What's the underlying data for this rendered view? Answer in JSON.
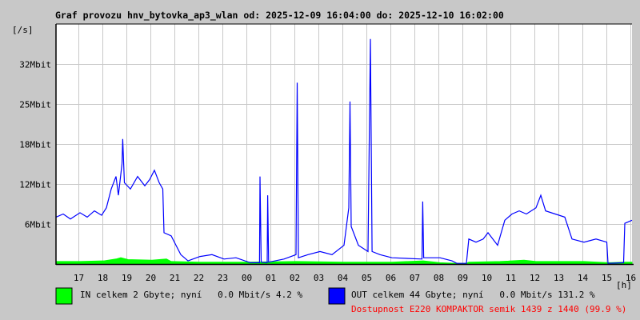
{
  "chart_data": {
    "type": "line",
    "title": "Graf provozu hnv_bytovka_ap3_wlan od: 2025-12-09 16:04:00 do: 2025-12-10 16:02:00",
    "ylabel": "[/s]",
    "xlabel": "[h]",
    "ylim": [
      0,
      38.4
    ],
    "x_unit": "hours since 16:04",
    "yticks": [
      {
        "value": 6.4,
        "label": "6Mbit"
      },
      {
        "value": 12.8,
        "label": "12Mbit"
      },
      {
        "value": 19.2,
        "label": "18Mbit"
      },
      {
        "value": 25.6,
        "label": "25Mbit"
      },
      {
        "value": 32,
        "label": "32Mbit"
      }
    ],
    "xticks": [
      {
        "value": 0.933,
        "label": "17"
      },
      {
        "value": 1.933,
        "label": "18"
      },
      {
        "value": 2.933,
        "label": "19"
      },
      {
        "value": 3.933,
        "label": "20"
      },
      {
        "value": 4.933,
        "label": "21"
      },
      {
        "value": 5.933,
        "label": "22"
      },
      {
        "value": 6.933,
        "label": "23"
      },
      {
        "value": 7.933,
        "label": "00"
      },
      {
        "value": 8.933,
        "label": "01"
      },
      {
        "value": 9.933,
        "label": "02"
      },
      {
        "value": 10.933,
        "label": "03"
      },
      {
        "value": 11.933,
        "label": "04"
      },
      {
        "value": 12.933,
        "label": "05"
      },
      {
        "value": 13.933,
        "label": "06"
      },
      {
        "value": 14.933,
        "label": "07"
      },
      {
        "value": 15.933,
        "label": "08"
      },
      {
        "value": 16.933,
        "label": "09"
      },
      {
        "value": 17.933,
        "label": "10"
      },
      {
        "value": 18.933,
        "label": "11"
      },
      {
        "value": 19.933,
        "label": "12"
      },
      {
        "value": 20.933,
        "label": "13"
      },
      {
        "value": 21.933,
        "label": "14"
      },
      {
        "value": 22.933,
        "label": "15"
      },
      {
        "value": 23.933,
        "label": "16"
      }
    ],
    "grid": true,
    "series": [
      {
        "name": "IN",
        "color": "#00ff00",
        "fill": true,
        "points": [
          [
            0,
            0.4
          ],
          [
            1,
            0.4
          ],
          [
            2,
            0.5
          ],
          [
            2.5,
            0.8
          ],
          [
            2.7,
            1.0
          ],
          [
            3,
            0.7
          ],
          [
            4,
            0.6
          ],
          [
            4.6,
            0.8
          ],
          [
            4.8,
            0.4
          ],
          [
            6,
            0.3
          ],
          [
            8,
            0.3
          ],
          [
            10,
            0.4
          ],
          [
            12,
            0.3
          ],
          [
            14,
            0.3
          ],
          [
            15.3,
            0.5
          ],
          [
            16,
            0.2
          ],
          [
            16.7,
            0.1
          ],
          [
            17.1,
            0.1
          ],
          [
            17.2,
            0.3
          ],
          [
            18.5,
            0.4
          ],
          [
            19.5,
            0.6
          ],
          [
            20,
            0.4
          ],
          [
            22,
            0.4
          ],
          [
            23,
            0.2
          ],
          [
            23.7,
            0.3
          ],
          [
            24,
            0.3
          ]
        ]
      },
      {
        "name": "OUT",
        "color": "#0000ff",
        "fill": false,
        "points": [
          [
            0,
            7.5
          ],
          [
            0.3,
            8
          ],
          [
            0.6,
            7.2
          ],
          [
            1,
            8.2
          ],
          [
            1.3,
            7.5
          ],
          [
            1.6,
            8.5
          ],
          [
            1.9,
            7.8
          ],
          [
            2.1,
            9
          ],
          [
            2.3,
            12
          ],
          [
            2.5,
            14
          ],
          [
            2.6,
            11
          ],
          [
            2.75,
            16
          ],
          [
            2.78,
            20
          ],
          [
            2.85,
            13
          ],
          [
            3.1,
            12
          ],
          [
            3.4,
            14
          ],
          [
            3.7,
            12.5
          ],
          [
            3.9,
            13.5
          ],
          [
            4.1,
            15
          ],
          [
            4.3,
            13
          ],
          [
            4.45,
            12
          ],
          [
            4.5,
            5
          ],
          [
            4.8,
            4.5
          ],
          [
            5,
            3
          ],
          [
            5.2,
            1.5
          ],
          [
            5.5,
            0.5
          ],
          [
            6,
            1.2
          ],
          [
            6.5,
            1.5
          ],
          [
            7,
            0.8
          ],
          [
            7.5,
            1
          ],
          [
            8.1,
            0.2
          ],
          [
            8.48,
            0.2
          ],
          [
            8.5,
            14
          ],
          [
            8.55,
            0.3
          ],
          [
            8.8,
            0.2
          ],
          [
            8.82,
            11
          ],
          [
            8.86,
            0.3
          ],
          [
            9.5,
            0.8
          ],
          [
            10,
            1.5
          ],
          [
            10.05,
            29
          ],
          [
            10.1,
            1
          ],
          [
            10.5,
            1.5
          ],
          [
            11,
            2
          ],
          [
            11.5,
            1.5
          ],
          [
            12,
            3
          ],
          [
            12.2,
            9
          ],
          [
            12.25,
            26
          ],
          [
            12.3,
            6
          ],
          [
            12.6,
            3
          ],
          [
            13,
            2
          ],
          [
            13.1,
            36
          ],
          [
            13.17,
            2
          ],
          [
            13.5,
            1.5
          ],
          [
            14,
            1
          ],
          [
            15.25,
            0.8
          ],
          [
            15.28,
            10
          ],
          [
            15.32,
            1
          ],
          [
            16,
            1
          ],
          [
            16.5,
            0.5
          ],
          [
            16.7,
            0.1
          ],
          [
            17.1,
            0.1
          ],
          [
            17.2,
            4
          ],
          [
            17.5,
            3.5
          ],
          [
            17.8,
            4
          ],
          [
            18,
            5
          ],
          [
            18.4,
            3
          ],
          [
            18.7,
            7
          ],
          [
            19,
            8
          ],
          [
            19.3,
            8.5
          ],
          [
            19.6,
            8
          ],
          [
            20,
            9
          ],
          [
            20.2,
            11
          ],
          [
            20.4,
            8.5
          ],
          [
            20.8,
            8
          ],
          [
            21.2,
            7.5
          ],
          [
            21.5,
            4
          ],
          [
            22,
            3.5
          ],
          [
            22.5,
            4
          ],
          [
            22.95,
            3.5
          ],
          [
            23,
            0.1
          ],
          [
            23.65,
            0.2
          ],
          [
            23.7,
            6.5
          ],
          [
            24,
            7
          ]
        ]
      }
    ]
  },
  "legend": {
    "in_text": "IN celkem 2 Gbyte; nyní   0.0 Mbit/s 4.2 %",
    "out_text": "OUT celkem 44 Gbyte; nyní   0.0 Mbit/s 131.2 %",
    "availability": "Dostupnost E220 KOMPAKTOR semik 1439 z 1440 (99.9 %)",
    "in_color": "#00ff00",
    "out_color": "#0000ff",
    "availability_color": "#ff0000"
  }
}
